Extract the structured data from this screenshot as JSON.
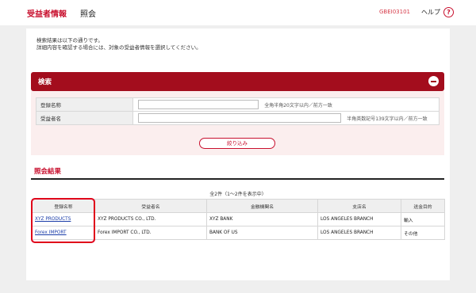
{
  "header": {
    "app_title": "受益者情報",
    "screen_name": "照会",
    "screen_id": "GBEI03101",
    "help_label": "ヘルプ",
    "help_icon": "?"
  },
  "intro": {
    "line1": "検索結果は以下の通りです。",
    "line2": "詳細内容を確認する場合には、対象の受益者情報を選択してください。"
  },
  "search": {
    "title": "検索",
    "collapse_icon": "minus-circle-icon",
    "fields": [
      {
        "label": "登録名称",
        "value": "",
        "hint": "全角半角20文字以内／前方一致"
      },
      {
        "label": "受益者名",
        "value": "",
        "hint": "半角英数記号139文字以内／前方一致"
      }
    ],
    "filter_button": "絞り込み"
  },
  "results": {
    "title": "照会結果",
    "count_text": "全2件（1～2件を表示中）",
    "columns": [
      "登録名称",
      "受益者名",
      "金融機関名",
      "支店名",
      "送金目的"
    ],
    "rows": [
      [
        "XYZ PRODUCTS",
        "XYZ PRODUCTS CO., LTD.",
        "XYZ BANK",
        "LOS ANGELES BRANCH",
        "輸入"
      ],
      [
        "Forex IMPORT",
        "Forex IMPORT CO., LTD.",
        "BANK OF US",
        "LOS ANGELES BRANCH",
        "その他"
      ]
    ]
  },
  "colors": {
    "brand_red": "#c8102e",
    "search_header": "#a30d1d",
    "highlight": "#e0001a",
    "link": "#1a3ca8"
  }
}
